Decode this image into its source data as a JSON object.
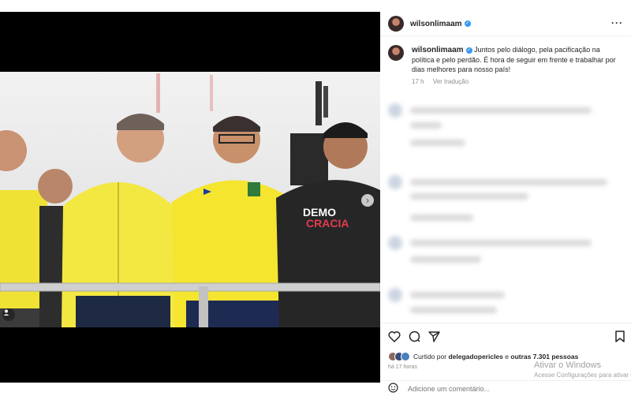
{
  "post": {
    "username": "wilsonlimaam",
    "caption": "Juntos pelo diálogo, pela pacificação na política e pelo perdão. É hora de seguir em frente e trabalhar por dias melhores para nosso país!",
    "time_ago": "17 h",
    "see_translation": "Ver tradução",
    "photo_shirt_text": "DEMOCRACIA"
  },
  "likes": {
    "prefix": "Curtido por",
    "first_user": "delegadopericles",
    "connector": "e",
    "others": "outras 7.301 pessoas"
  },
  "timestamp": "há 17 horas",
  "comment": {
    "placeholder": "Adicione um comentário..."
  },
  "watermark": {
    "line1": "Ativar o Windows",
    "line2": "Acesse Configurações para ativar o"
  },
  "icons": [
    "heart-icon",
    "comment-icon",
    "share-icon",
    "save-icon",
    "more-icon",
    "emoji-icon",
    "user-tag-icon",
    "chevron-right-icon",
    "verified-badge-icon"
  ],
  "colors": {
    "verified": "#3897f0",
    "jersey_yellow": "#f1e23a",
    "text": "#262626",
    "muted": "#8e8e8e"
  }
}
